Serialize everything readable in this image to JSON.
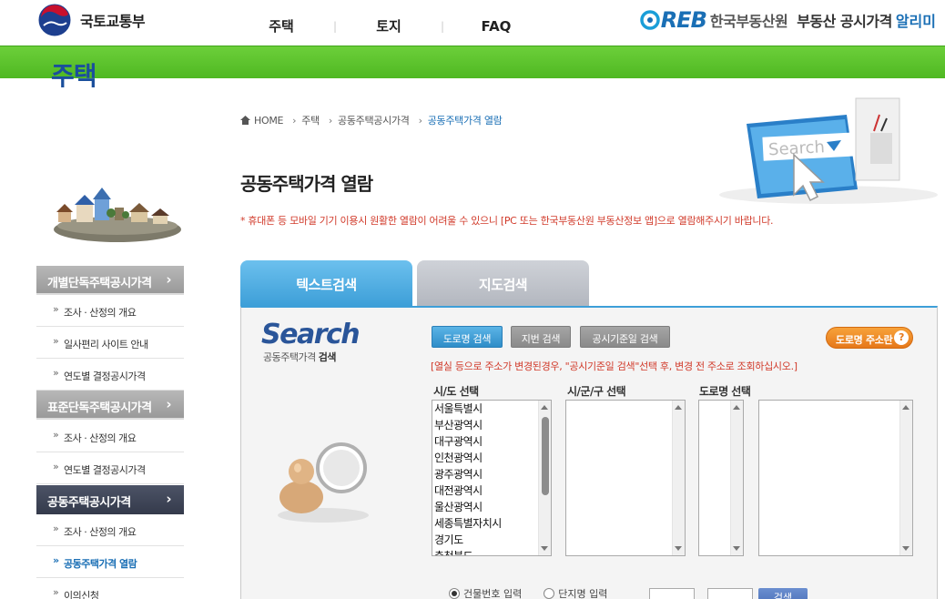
{
  "header": {
    "ministry": "국토교통부",
    "nav": [
      "주택",
      "토지",
      "FAQ"
    ],
    "nav_sep": "|",
    "reb_logo": "REB",
    "reb_org": "한국부동산원",
    "reb_title": "부동산 공시가격",
    "reb_title_accent": "알리미"
  },
  "sidebar": {
    "title": "주택",
    "sections": [
      {
        "label": "개별단독주택공시가격",
        "items": [
          "조사 · 산정의 개요",
          "일사편리 사이트 안내",
          "연도별 결정공시가격"
        ]
      },
      {
        "label": "표준단독주택공시가격",
        "items": [
          "조사 · 산정의 개요",
          "연도별 결정공시가격"
        ]
      },
      {
        "label": "공동주택공시가격",
        "items": [
          "조사 · 산정의 개요",
          "공동주택가격 열람",
          "이의신청"
        ]
      }
    ],
    "arrow": "›"
  },
  "breadcrumb": [
    "HOME",
    "주택",
    "공동주택공시가격",
    "공동주택가격 열람"
  ],
  "page": {
    "title": "공동주택가격 열람",
    "notice": "* 휴대폰 등 모바일 기기 이용시 원활한 열람이 어려울 수 있으니 [PC 또는 한국부동산원 부동산정보 앱]으로 열람해주시기 바랍니다."
  },
  "illustration": {
    "search_text": "Search"
  },
  "tabs": [
    "텍스트검색",
    "지도검색"
  ],
  "search": {
    "logo": "Search",
    "sub_prefix": "공동주택가격",
    "sub_bold": "검색",
    "buttons": [
      "도로명 검색",
      "지번 검색",
      "공시기준일 검색"
    ],
    "addr_button": "도로명 주소란",
    "addr_help": "?",
    "notice": "[열실 등으로 주소가 변경된경우, \"공시기준일 검색\"선택 후, 변경 전 주소로 조회하십시오.]",
    "col_labels": [
      "시/도 선택",
      "시/군/구 선택",
      "도로명 선택"
    ],
    "sido_options": [
      "서울특별시",
      "부산광역시",
      "대구광역시",
      "인천광역시",
      "광주광역시",
      "대전광역시",
      "울산광역시",
      "세종특별자치시",
      "경기도",
      "충청북도"
    ],
    "bottom": {
      "radio1": "건물번호 입력",
      "radio2": "단지명 입력",
      "button": "검색"
    }
  },
  "colors": {
    "accent_blue": "#3d9fd8",
    "green_bar": "#5bc22b",
    "notice_red": "#d13a2a",
    "nav_dark": "#3a4052"
  }
}
